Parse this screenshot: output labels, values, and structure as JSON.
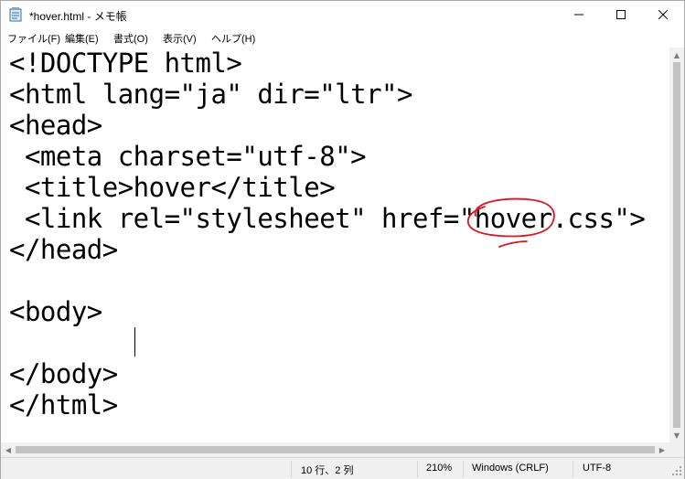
{
  "window": {
    "title": "*hover.html - メモ帳"
  },
  "menu": [
    {
      "label": "ファイル(F)"
    },
    {
      "label": "編集(E)"
    },
    {
      "label": "書式(O)"
    },
    {
      "label": "表示(V)"
    },
    {
      "label": "ヘルプ(H)"
    }
  ],
  "editor": {
    "lines": [
      "<!DOCTYPE html>",
      "<html lang=\"ja\" dir=\"ltr\">",
      "<head>",
      " <meta charset=\"utf-8\">",
      " <title>hover</title>",
      " <link rel=\"stylesheet\" href=\"hover.css\">",
      "</head>",
      "",
      "<body>",
      "",
      "</body>",
      "</html>"
    ],
    "annotation_color": "#e0141e"
  },
  "status": {
    "position": "10 行、2 列",
    "zoom": "210%",
    "line_ending": "Windows (CRLF)",
    "encoding": "UTF-8"
  },
  "icons": {
    "app": "notepad-icon",
    "minimize": "minimize-icon",
    "maximize": "maximize-icon",
    "close": "close-icon"
  }
}
